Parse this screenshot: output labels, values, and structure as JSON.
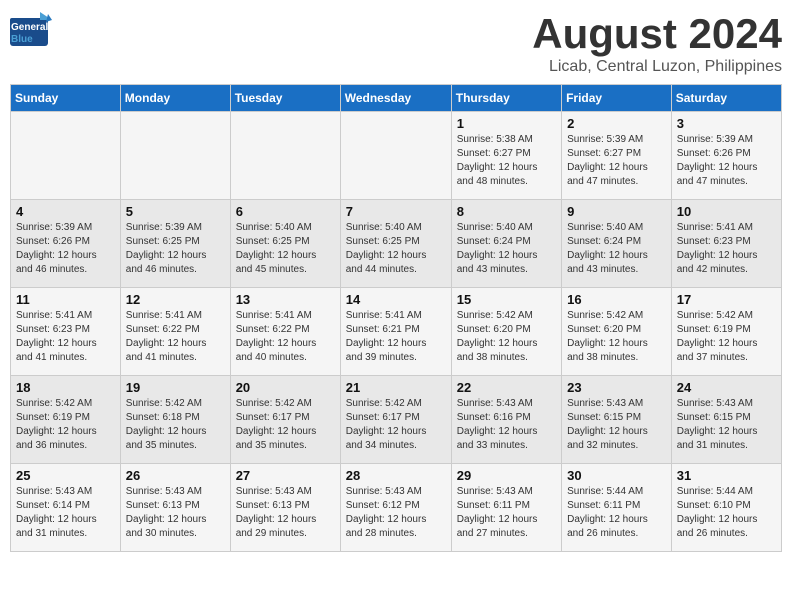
{
  "header": {
    "logo_general": "General",
    "logo_blue": "Blue",
    "month_year": "August 2024",
    "location": "Licab, Central Luzon, Philippines"
  },
  "weekdays": [
    "Sunday",
    "Monday",
    "Tuesday",
    "Wednesday",
    "Thursday",
    "Friday",
    "Saturday"
  ],
  "weeks": [
    [
      {
        "day": "",
        "info": ""
      },
      {
        "day": "",
        "info": ""
      },
      {
        "day": "",
        "info": ""
      },
      {
        "day": "",
        "info": ""
      },
      {
        "day": "1",
        "info": "Sunrise: 5:38 AM\nSunset: 6:27 PM\nDaylight: 12 hours\nand 48 minutes."
      },
      {
        "day": "2",
        "info": "Sunrise: 5:39 AM\nSunset: 6:27 PM\nDaylight: 12 hours\nand 47 minutes."
      },
      {
        "day": "3",
        "info": "Sunrise: 5:39 AM\nSunset: 6:26 PM\nDaylight: 12 hours\nand 47 minutes."
      }
    ],
    [
      {
        "day": "4",
        "info": "Sunrise: 5:39 AM\nSunset: 6:26 PM\nDaylight: 12 hours\nand 46 minutes."
      },
      {
        "day": "5",
        "info": "Sunrise: 5:39 AM\nSunset: 6:25 PM\nDaylight: 12 hours\nand 46 minutes."
      },
      {
        "day": "6",
        "info": "Sunrise: 5:40 AM\nSunset: 6:25 PM\nDaylight: 12 hours\nand 45 minutes."
      },
      {
        "day": "7",
        "info": "Sunrise: 5:40 AM\nSunset: 6:25 PM\nDaylight: 12 hours\nand 44 minutes."
      },
      {
        "day": "8",
        "info": "Sunrise: 5:40 AM\nSunset: 6:24 PM\nDaylight: 12 hours\nand 43 minutes."
      },
      {
        "day": "9",
        "info": "Sunrise: 5:40 AM\nSunset: 6:24 PM\nDaylight: 12 hours\nand 43 minutes."
      },
      {
        "day": "10",
        "info": "Sunrise: 5:41 AM\nSunset: 6:23 PM\nDaylight: 12 hours\nand 42 minutes."
      }
    ],
    [
      {
        "day": "11",
        "info": "Sunrise: 5:41 AM\nSunset: 6:23 PM\nDaylight: 12 hours\nand 41 minutes."
      },
      {
        "day": "12",
        "info": "Sunrise: 5:41 AM\nSunset: 6:22 PM\nDaylight: 12 hours\nand 41 minutes."
      },
      {
        "day": "13",
        "info": "Sunrise: 5:41 AM\nSunset: 6:22 PM\nDaylight: 12 hours\nand 40 minutes."
      },
      {
        "day": "14",
        "info": "Sunrise: 5:41 AM\nSunset: 6:21 PM\nDaylight: 12 hours\nand 39 minutes."
      },
      {
        "day": "15",
        "info": "Sunrise: 5:42 AM\nSunset: 6:20 PM\nDaylight: 12 hours\nand 38 minutes."
      },
      {
        "day": "16",
        "info": "Sunrise: 5:42 AM\nSunset: 6:20 PM\nDaylight: 12 hours\nand 38 minutes."
      },
      {
        "day": "17",
        "info": "Sunrise: 5:42 AM\nSunset: 6:19 PM\nDaylight: 12 hours\nand 37 minutes."
      }
    ],
    [
      {
        "day": "18",
        "info": "Sunrise: 5:42 AM\nSunset: 6:19 PM\nDaylight: 12 hours\nand 36 minutes."
      },
      {
        "day": "19",
        "info": "Sunrise: 5:42 AM\nSunset: 6:18 PM\nDaylight: 12 hours\nand 35 minutes."
      },
      {
        "day": "20",
        "info": "Sunrise: 5:42 AM\nSunset: 6:17 PM\nDaylight: 12 hours\nand 35 minutes."
      },
      {
        "day": "21",
        "info": "Sunrise: 5:42 AM\nSunset: 6:17 PM\nDaylight: 12 hours\nand 34 minutes."
      },
      {
        "day": "22",
        "info": "Sunrise: 5:43 AM\nSunset: 6:16 PM\nDaylight: 12 hours\nand 33 minutes."
      },
      {
        "day": "23",
        "info": "Sunrise: 5:43 AM\nSunset: 6:15 PM\nDaylight: 12 hours\nand 32 minutes."
      },
      {
        "day": "24",
        "info": "Sunrise: 5:43 AM\nSunset: 6:15 PM\nDaylight: 12 hours\nand 31 minutes."
      }
    ],
    [
      {
        "day": "25",
        "info": "Sunrise: 5:43 AM\nSunset: 6:14 PM\nDaylight: 12 hours\nand 31 minutes."
      },
      {
        "day": "26",
        "info": "Sunrise: 5:43 AM\nSunset: 6:13 PM\nDaylight: 12 hours\nand 30 minutes."
      },
      {
        "day": "27",
        "info": "Sunrise: 5:43 AM\nSunset: 6:13 PM\nDaylight: 12 hours\nand 29 minutes."
      },
      {
        "day": "28",
        "info": "Sunrise: 5:43 AM\nSunset: 6:12 PM\nDaylight: 12 hours\nand 28 minutes."
      },
      {
        "day": "29",
        "info": "Sunrise: 5:43 AM\nSunset: 6:11 PM\nDaylight: 12 hours\nand 27 minutes."
      },
      {
        "day": "30",
        "info": "Sunrise: 5:44 AM\nSunset: 6:11 PM\nDaylight: 12 hours\nand 26 minutes."
      },
      {
        "day": "31",
        "info": "Sunrise: 5:44 AM\nSunset: 6:10 PM\nDaylight: 12 hours\nand 26 minutes."
      }
    ]
  ]
}
